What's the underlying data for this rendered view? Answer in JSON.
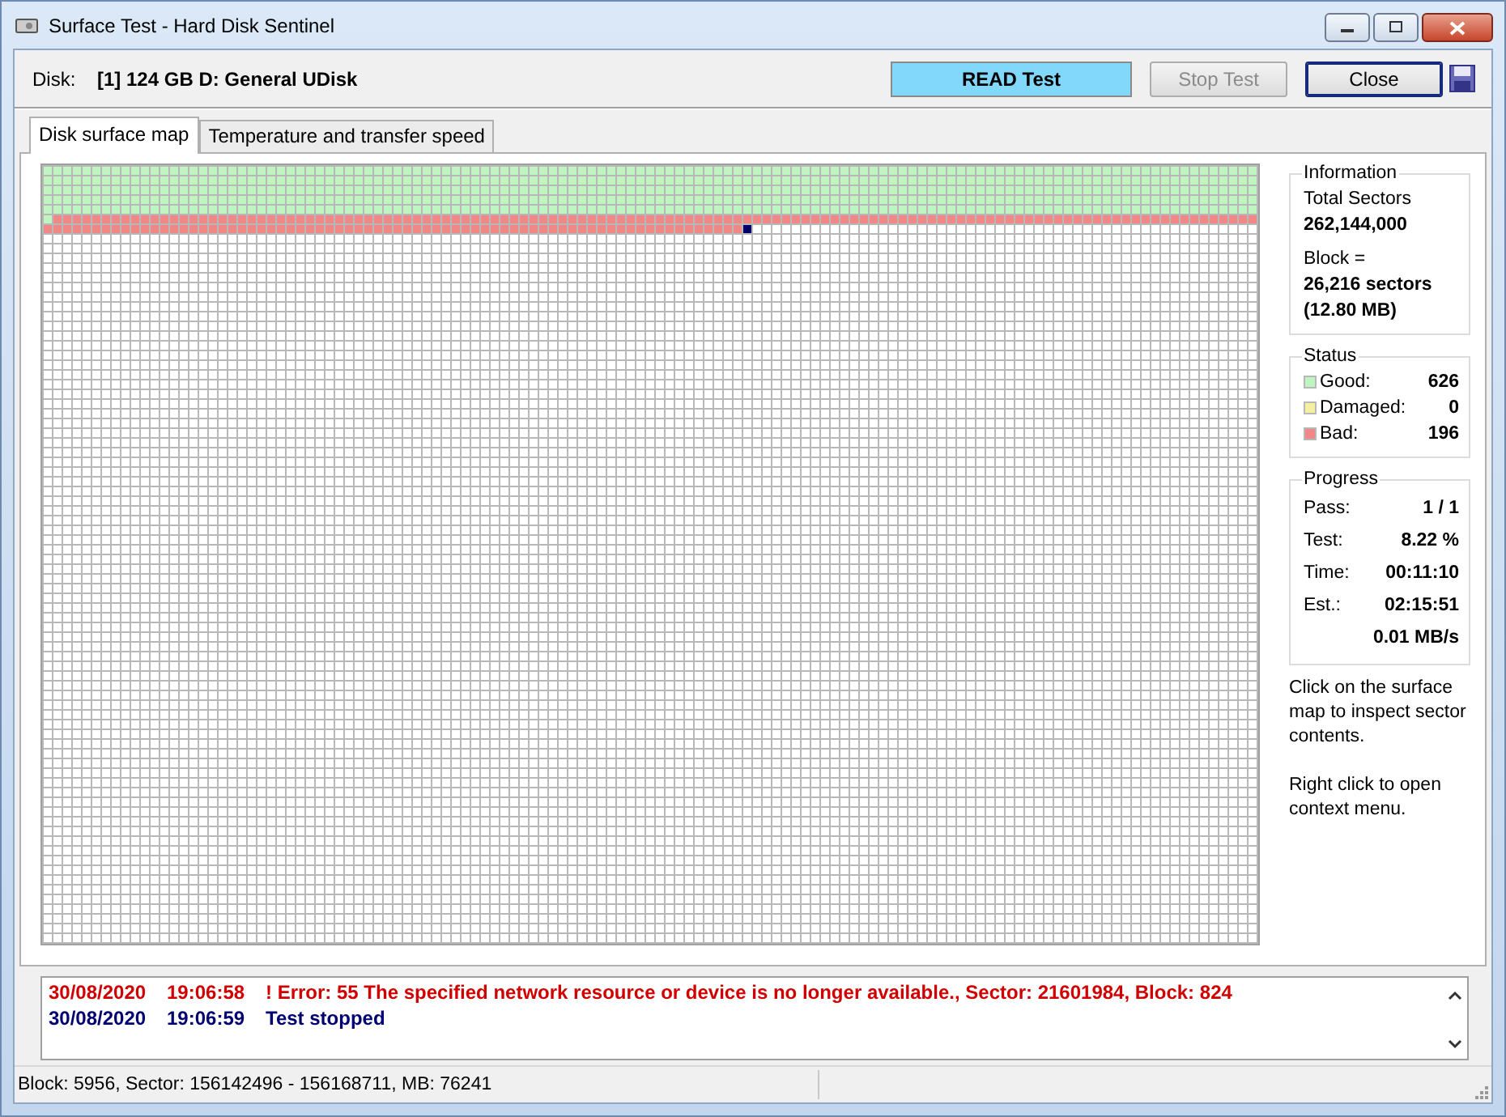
{
  "window": {
    "title": "Surface Test - Hard Disk Sentinel"
  },
  "disk": {
    "label": "Disk:",
    "value": "[1] 124 GB D: General UDisk"
  },
  "buttons": [
    {
      "label": "READ Test",
      "kind": "mode",
      "disabled": false
    },
    {
      "label": "Stop Test",
      "kind": "action",
      "disabled": true
    },
    {
      "label": "Close",
      "kind": "action",
      "disabled": false
    }
  ],
  "tabs": [
    {
      "label": "Disk surface map",
      "selected": true
    },
    {
      "label": "Temperature and transfer speed",
      "selected": false
    }
  ],
  "information": {
    "title": "Information",
    "total_label": "Total Sectors",
    "total_value": "262,144,000",
    "block_label": "Block =",
    "block_value": "26,216 sectors",
    "block_size": "(12.80 MB)"
  },
  "status": {
    "title": "Status",
    "items": [
      {
        "kind": "good",
        "label": "Good:",
        "value": "626",
        "color": "#c0f4c0"
      },
      {
        "kind": "damaged",
        "label": "Damaged:",
        "value": "0",
        "color": "#f4f0a0"
      },
      {
        "kind": "bad",
        "label": "Bad:",
        "value": "196",
        "color": "#f08888"
      }
    ]
  },
  "progress": {
    "title": "Progress",
    "rows": [
      {
        "label": "Pass:",
        "value": "1 / 1"
      },
      {
        "label": "Test:",
        "value": "8.22 %"
      },
      {
        "label": "Time:",
        "value": "00:11:10"
      },
      {
        "label": "Est.:",
        "value": "02:15:51"
      },
      {
        "value": "0.01 MB/s"
      }
    ]
  },
  "hints": [
    "Click on the surface map to inspect sector contents.",
    "Right click to open context menu."
  ],
  "log": [
    {
      "kind": "error",
      "date": "30/08/2020",
      "time": "19:06:58",
      "message": "! Error: 55 The specified network resource or device is no longer available., Sector: 21601984, Block: 824"
    },
    {
      "kind": "info",
      "date": "30/08/2020",
      "time": "19:06:59",
      "message": "Test stopped"
    }
  ],
  "status_bar": {
    "text": "Block: 5956, Sector: 156142496 - 156168711, MB: 76241"
  }
}
